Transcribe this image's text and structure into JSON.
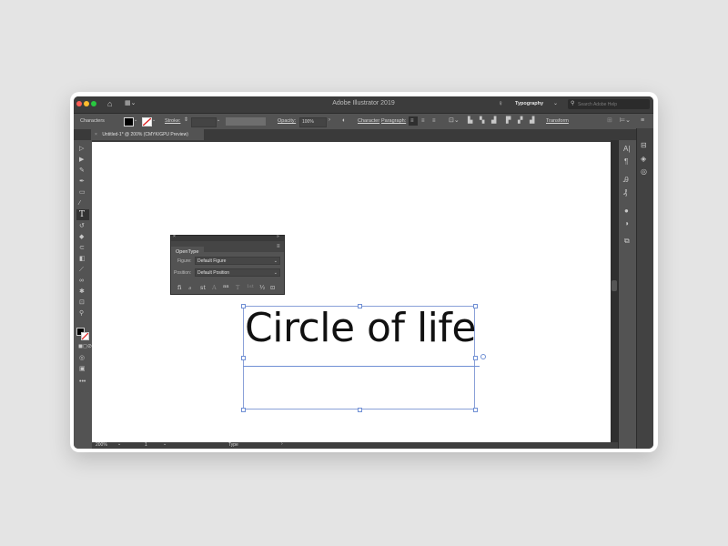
{
  "window": {
    "title": "Adobe Illustrator 2019",
    "workspace": "Typography",
    "search_placeholder": "Search Adobe Help"
  },
  "control_bar": {
    "mode_label": "Characters",
    "stroke_label": "Stroke:",
    "opacity_label": "Opacity:",
    "opacity_value": "100%",
    "character_link": "Character",
    "paragraph_link": "Paragraph:",
    "transform_link": "Transform"
  },
  "document_tab": {
    "label": "Untitled-1* @ 200% (CMYK/GPU Preview)"
  },
  "opentype_panel": {
    "tab_label": "OpenType",
    "figure_label": "Figure:",
    "figure_value": "Default Figure",
    "position_label": "Position:",
    "position_value": "Default Position",
    "glyph_buttons": [
      "fi",
      "ℴ",
      "st",
      "A",
      "aa",
      "T",
      "1st",
      "½",
      "⊡"
    ]
  },
  "canvas": {
    "text": "Circle of life"
  },
  "status_bar": {
    "zoom": "200%",
    "artboard": "1",
    "tool": "Type"
  },
  "colors": {
    "app_bg": "#323232",
    "panel_bg": "#535353",
    "selection": "#6f8fd4",
    "close": "#ff5f57",
    "minimize": "#febc2e",
    "maximize": "#28c840"
  }
}
